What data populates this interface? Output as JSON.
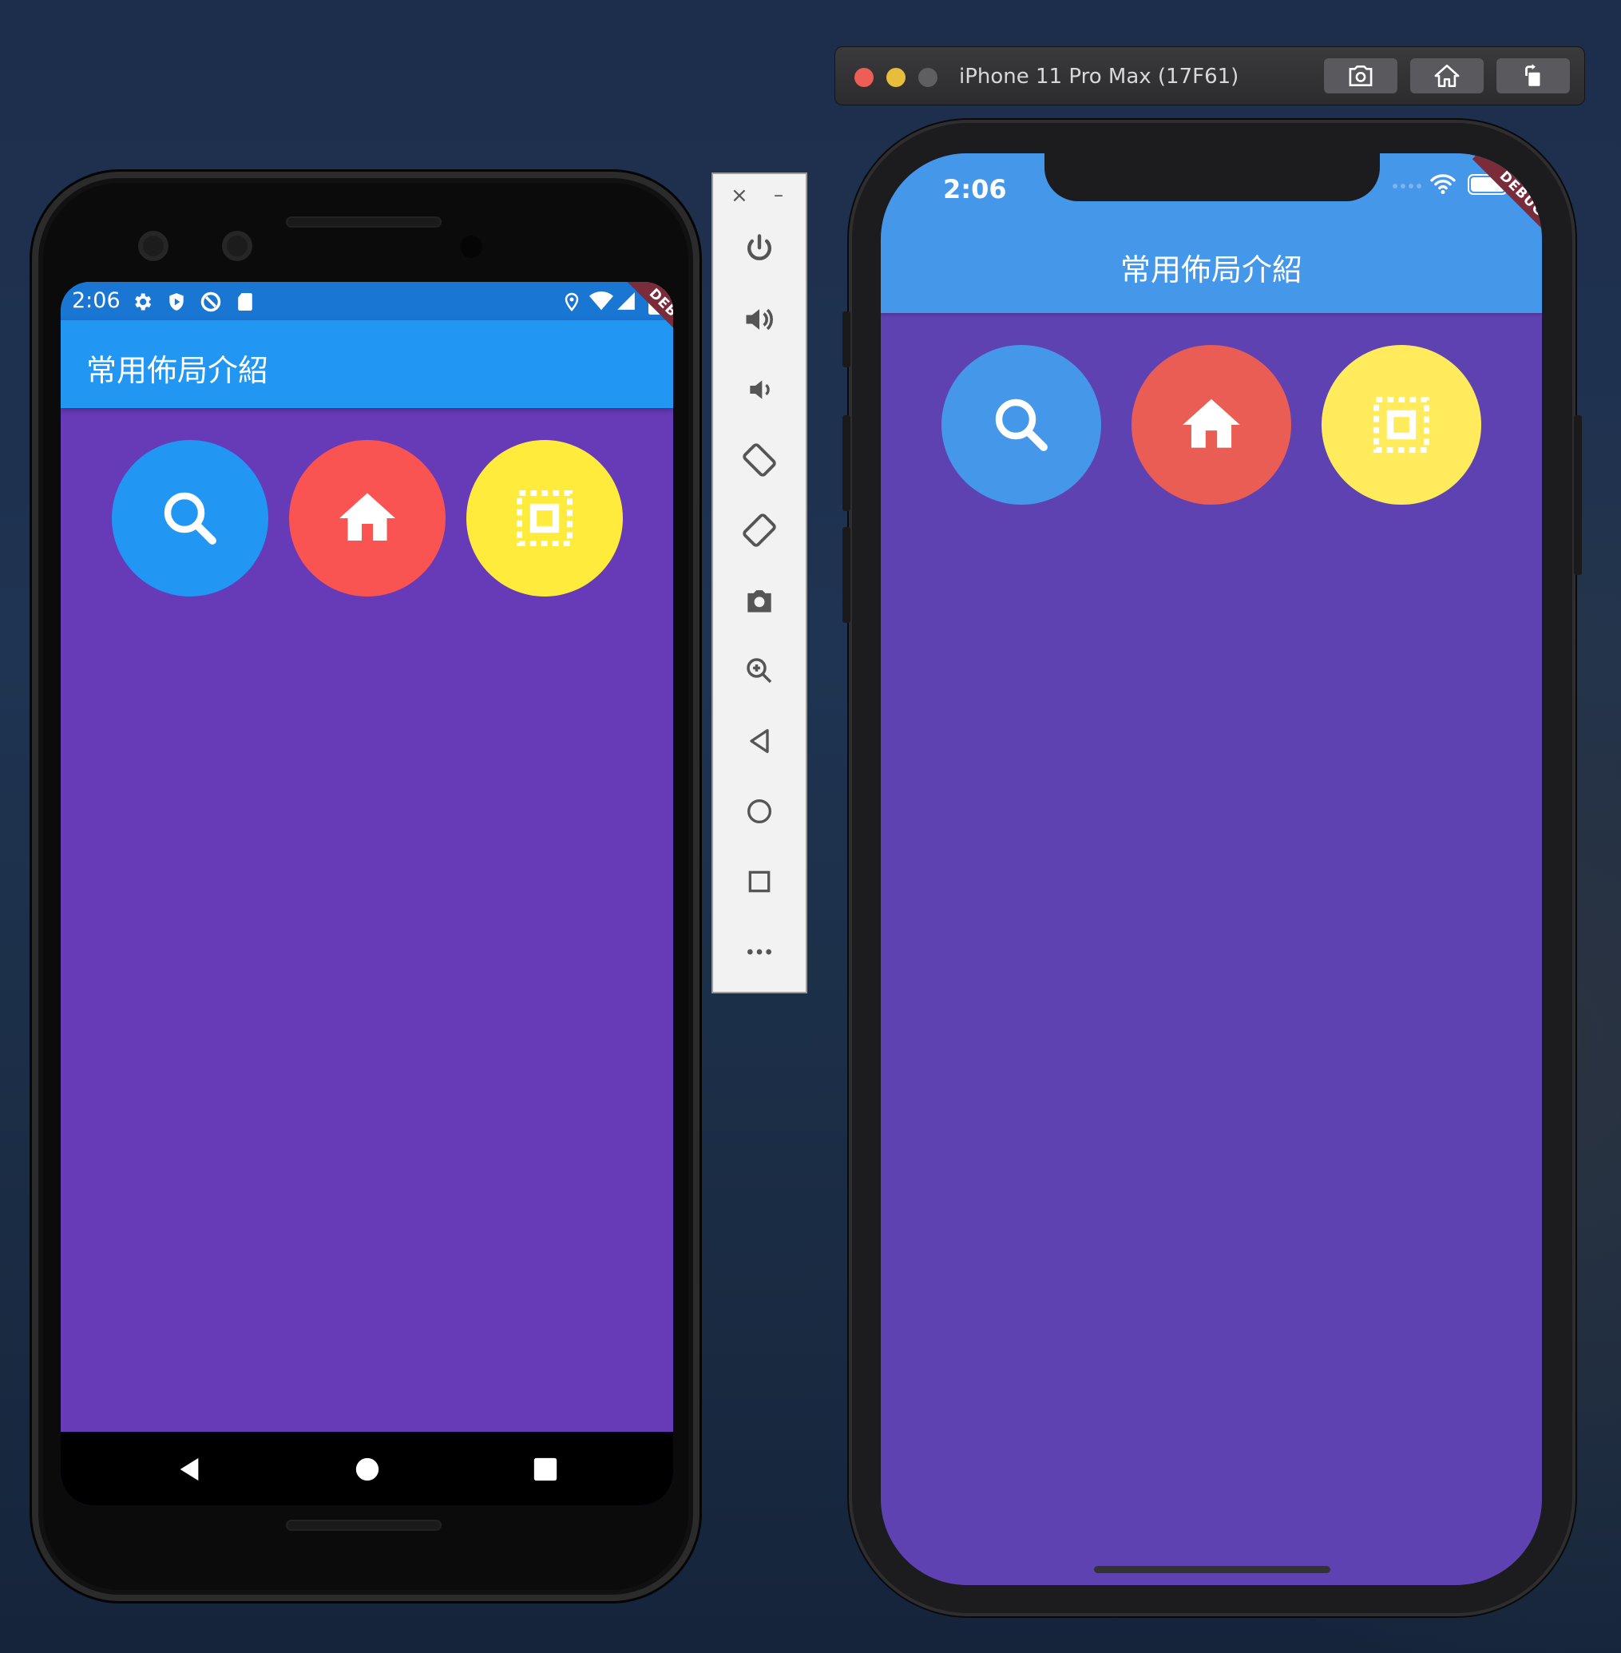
{
  "android": {
    "status_time": "2:06",
    "appbar_title": "常用佈局介紹",
    "debug_label": "DEBUG",
    "buttons": [
      {
        "icon": "search-icon",
        "color": "#2196f3"
      },
      {
        "icon": "home-icon",
        "color": "#f95452"
      },
      {
        "icon": "select-all-icon",
        "color": "#ffeb3b"
      }
    ],
    "background": "#673ab7"
  },
  "toolbar": {
    "close_label": "×",
    "minimize_label": "–",
    "items": [
      "power-icon",
      "volume-up-icon",
      "volume-down-icon",
      "rotate-left-icon",
      "rotate-right-icon",
      "camera-icon",
      "zoom-icon",
      "back-icon",
      "home-icon",
      "overview-icon",
      "more-icon"
    ]
  },
  "ios": {
    "window_title": "iPhone 11 Pro Max (17F61)",
    "status_time": "2:06",
    "appbar_title": "常用佈局介紹",
    "debug_label": "DEBUG",
    "buttons": [
      {
        "icon": "search-icon",
        "color": "#4597ea"
      },
      {
        "icon": "home-icon",
        "color": "#e95d54"
      },
      {
        "icon": "select-all-icon",
        "color": "#ffeb5b"
      }
    ],
    "background": "#5e42b1"
  }
}
